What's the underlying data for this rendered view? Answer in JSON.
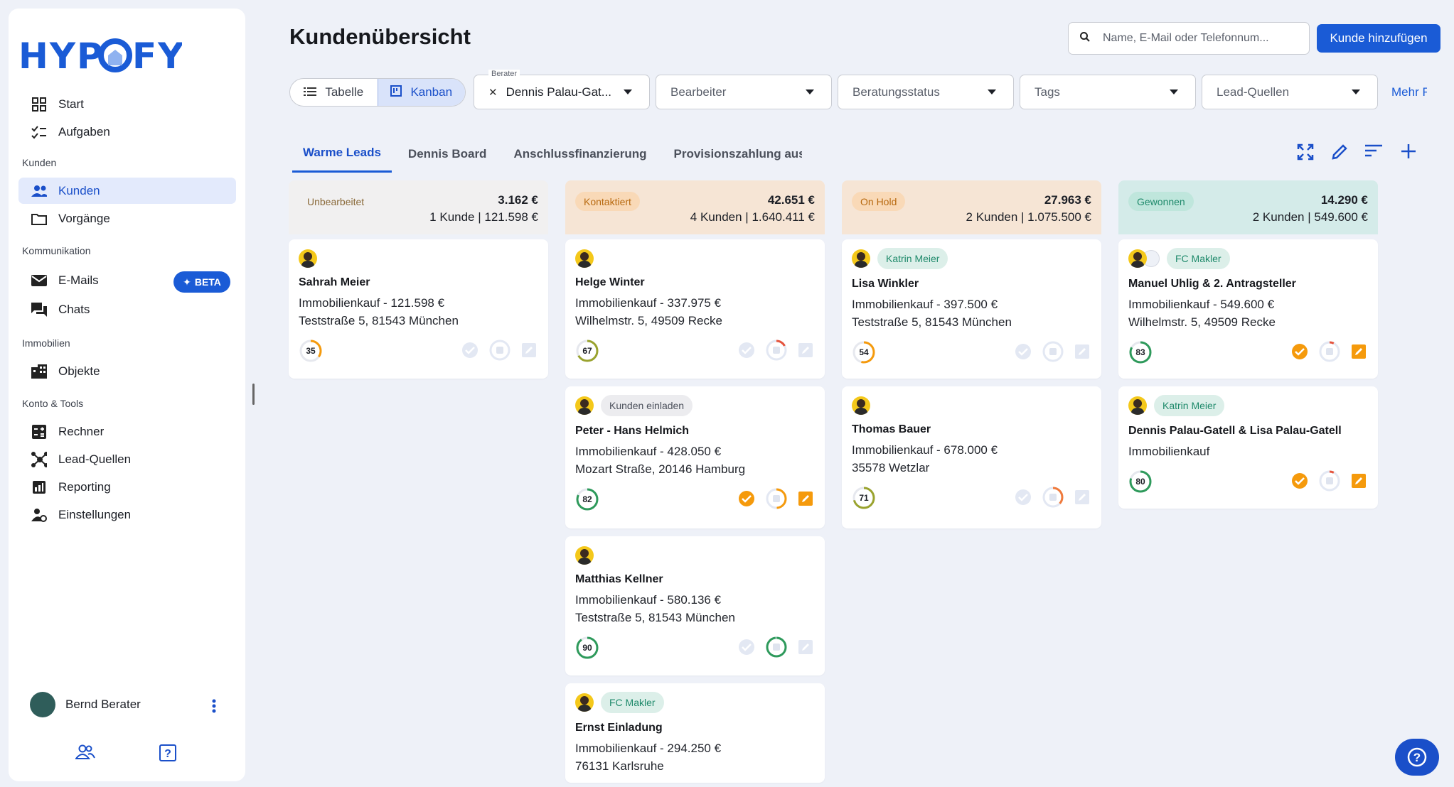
{
  "app": {
    "logo": "HYPOFY"
  },
  "sidebar": {
    "items": [
      {
        "label": "Start",
        "icon": "grid-icon"
      },
      {
        "label": "Aufgaben",
        "icon": "checklist-icon"
      },
      {
        "label": "Kunden",
        "icon": "people-icon",
        "active": true
      },
      {
        "label": "Vorgänge",
        "icon": "folder-icon"
      },
      {
        "label": "E-Mails",
        "icon": "mail-icon"
      },
      {
        "label": "Chats",
        "icon": "chat-icon"
      },
      {
        "label": "Objekte",
        "icon": "building-icon"
      },
      {
        "label": "Rechner",
        "icon": "calculator-icon"
      },
      {
        "label": "Lead-Quellen",
        "icon": "network-icon"
      },
      {
        "label": "Reporting",
        "icon": "chart-icon"
      },
      {
        "label": "Einstellungen",
        "icon": "user-gear-icon"
      }
    ],
    "sections": [
      "Kunden",
      "Kommunikation",
      "Immobilien",
      "Konto & Tools"
    ],
    "beta_label": "BETA",
    "user_name": "Bernd Berater"
  },
  "header": {
    "title": "Kundenübersicht",
    "search_placeholder": "Name, E-Mail oder Telefonnum...",
    "add_button": "Kunde hinzufügen"
  },
  "filters": {
    "view_table": "Tabelle",
    "view_kanban": "Kanban",
    "berater_label": "Berater",
    "berater_value": "Dennis Palau-Gat...",
    "bearbeiter": "Bearbeiter",
    "beratungsstatus": "Beratungsstatus",
    "tags": "Tags",
    "lead_quellen": "Lead-Quellen",
    "more": "Mehr F"
  },
  "tabs": [
    "Warme Leads",
    "Dennis Board",
    "Anschlussfinanzierung",
    "Provisionszahlung ausst"
  ],
  "colors": {
    "accent": "#1a5bd6",
    "orange": "#f59a0c",
    "green": "#2e9a5b"
  },
  "columns": [
    {
      "status": "Unbearbeitet",
      "sum": "3.162 €",
      "meta": "1 Kunde | 121.598 €",
      "cards": [
        {
          "name": "Sahrah Meier",
          "line1": "Immobilienkauf - 121.598 €",
          "line2": "Teststraße 5, 81543 München",
          "score": "35"
        }
      ]
    },
    {
      "status": "Kontaktiert",
      "sum": "42.651 €",
      "meta": "4 Kunden | 1.640.411 €",
      "cards": [
        {
          "name": "Helge Winter",
          "line1": "Immobilienkauf - 337.975 €",
          "line2": "Wilhelmstr. 5, 49509 Recke",
          "score": "67"
        },
        {
          "tag": "Kunden einladen",
          "name": "Peter - Hans Helmich",
          "line1": "Immobilienkauf - 428.050 €",
          "line2": "Mozart Straße, 20146 Hamburg",
          "score": "82"
        },
        {
          "name": "Matthias Kellner",
          "line1": "Immobilienkauf - 580.136 €",
          "line2": "Teststraße 5, 81543 München",
          "score": "90"
        },
        {
          "tag": "FC Makler",
          "name": "Ernst Einladung",
          "line1": "Immobilienkauf - 294.250 €",
          "line2": "76131 Karlsruhe"
        }
      ]
    },
    {
      "status": "On Hold",
      "sum": "27.963 €",
      "meta": "2 Kunden | 1.075.500 €",
      "cards": [
        {
          "tag": "Katrin Meier",
          "name": "Lisa Winkler",
          "line1": "Immobilienkauf - 397.500 €",
          "line2": "Teststraße 5, 81543 München",
          "score": "54"
        },
        {
          "name": "Thomas Bauer",
          "line1": "Immobilienkauf - 678.000 €",
          "line2": "35578 Wetzlar",
          "score": "71"
        }
      ]
    },
    {
      "status": "Gewonnen",
      "sum": "14.290 €",
      "meta": "2 Kunden | 549.600 €",
      "cards": [
        {
          "tag": "FC Makler",
          "name": "Manuel Uhlig & 2. Antragsteller",
          "line1": "Immobilienkauf - 549.600 €",
          "line2": "Wilhelmstr. 5, 49509 Recke",
          "score": "83"
        },
        {
          "tag": "Katrin Meier",
          "name": "Dennis Palau-Gatell & Lisa Palau-Gatell",
          "line1": "Immobilienkauf",
          "score": "80"
        }
      ]
    }
  ]
}
